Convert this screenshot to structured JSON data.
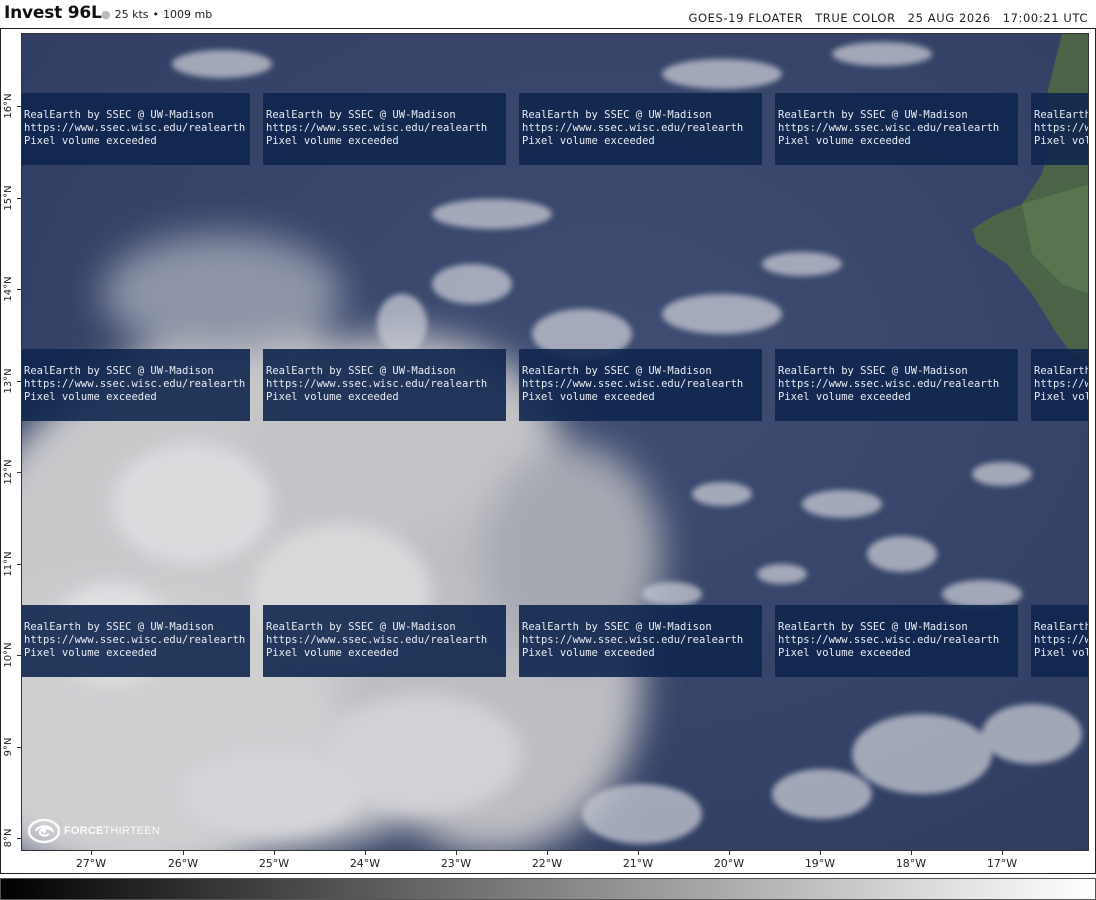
{
  "header": {
    "storm_name": "Invest 96L",
    "wind": "25 kts",
    "pressure": "1009 mb",
    "satellite": "GOES-19",
    "product": "FLOATER",
    "enhancement": "TRUE COLOR",
    "date": "25 AUG 2026",
    "time": "17:00:21 UTC"
  },
  "overlay_tile": {
    "line1": "RealEarth by SSEC @ UW-Madison",
    "line2": "https://www.ssec.wisc.edu/realearth",
    "line3": "Pixel volume exceeded"
  },
  "axes": {
    "latitudes": [
      "16°N",
      "15°N",
      "14°N",
      "13°N",
      "12°N",
      "11°N",
      "10°N",
      "9°N",
      "8°N"
    ],
    "longitudes": [
      "27°W",
      "26°W",
      "25°W",
      "24°W",
      "23°W",
      "22°W",
      "21°W",
      "20°W",
      "19°W",
      "18°W",
      "17°W"
    ]
  },
  "logo": {
    "part1": "FORCE",
    "part2": "THIRTEEN",
    "icon": "swirl-icon"
  },
  "colorbar": {
    "gradient": [
      "#000000",
      "#ffffff"
    ]
  },
  "colors": {
    "ocean": "#3c4a6e",
    "land": "#4d6a4a",
    "tile_bg": "#10264e",
    "cloud": "#e8e8ea"
  }
}
